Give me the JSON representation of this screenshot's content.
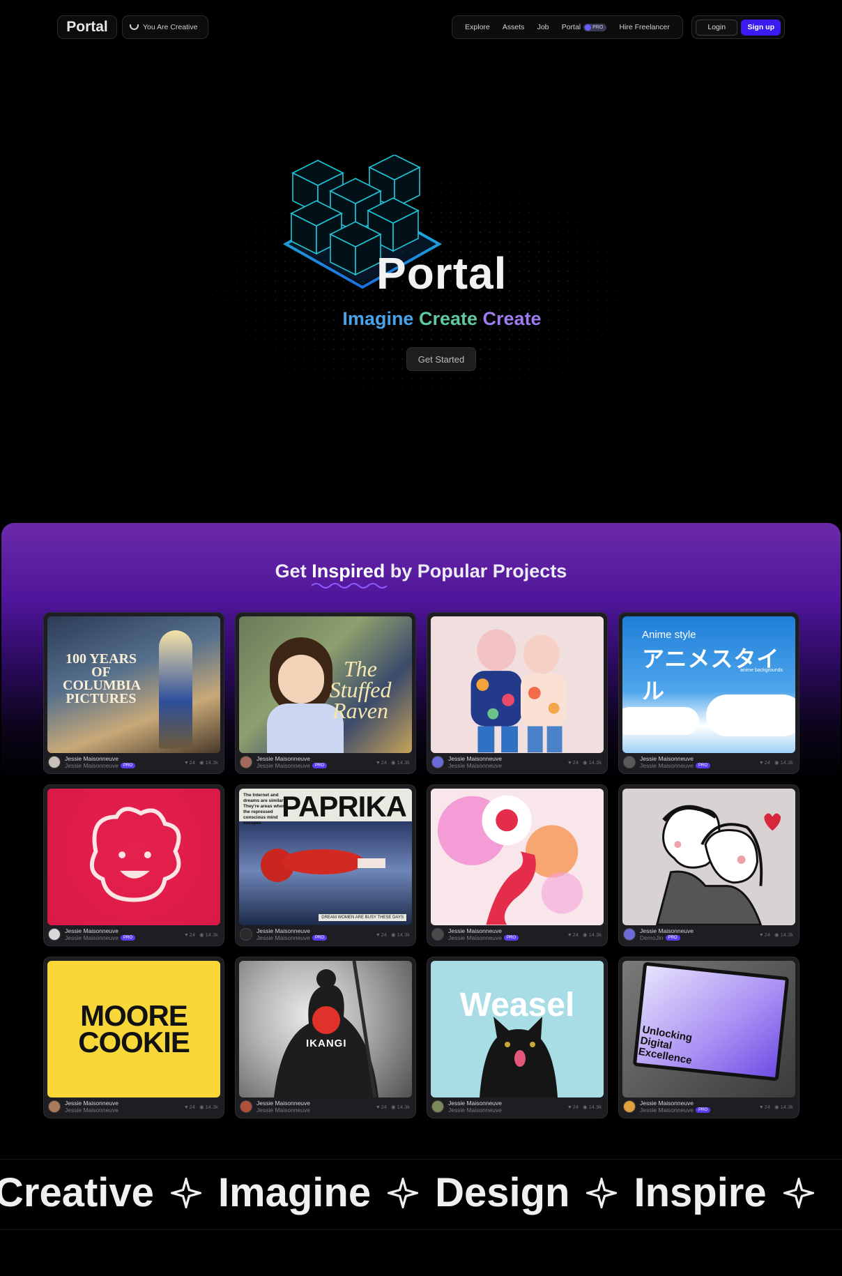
{
  "nav": {
    "logo": "Portal",
    "creative_pill": "You Are Creative",
    "menu": {
      "explore": "Explore",
      "assets": "Assets",
      "job": "Job",
      "portal": "Portal",
      "portal_badge": "PRO",
      "hire": "Hire Freelancer"
    },
    "login": "Login",
    "signup": "Sign up"
  },
  "hero": {
    "title": "Portal",
    "tagline": [
      "Imagine",
      "Create",
      "Create"
    ],
    "cta": "Get Started"
  },
  "inspired": {
    "title_prefix": "Get",
    "title_em": "Inspired",
    "title_suffix": "by Popular Projects",
    "cards": [
      {
        "author": "Jessie Maisonneuve",
        "sub": "Jessie Maisonneuve",
        "pro": "PRO",
        "likes": "24",
        "views": "14.3k",
        "art_text": "100 YEARS OF COLUMBIA PICTURES"
      },
      {
        "author": "Jessie Maisonneuve",
        "sub": "Jessie Maisonneuve",
        "pro": "PRO",
        "likes": "24",
        "views": "14.3k",
        "art_text": "The Stuffed Raven"
      },
      {
        "author": "Jessie Maisonneuve",
        "sub": "Jessie Maisonneuve",
        "pro": "",
        "likes": "24",
        "views": "14.3k",
        "art_text": ""
      },
      {
        "author": "Jessie Maisonneuve",
        "sub": "Jessie Maisonneuve",
        "pro": "PRO",
        "likes": "24",
        "views": "14.3k",
        "art_text": "Anime style",
        "art_jp": "アニメスタイル",
        "art_sub": "anime backgrounds"
      },
      {
        "author": "Jessie Maisonneuve",
        "sub": "Jessie Maisonneuve",
        "pro": "PRO",
        "likes": "24",
        "views": "14.3k",
        "art_text": ""
      },
      {
        "author": "Jessie Maisonneuve",
        "sub": "Jessie Maisonneuve",
        "pro": "PRO",
        "likes": "24",
        "views": "14.3k",
        "art_text": "PAPRIKA",
        "art_small": "The Internet and dreams are similar They're areas where the repressed conscious mind escapes",
        "art_foot": "DREAM WOMEN ARE BUSY THESE DAYS"
      },
      {
        "author": "Jessie Maisonneuve",
        "sub": "Jessie Maisonneuve",
        "pro": "PRO",
        "likes": "24",
        "views": "14.3k",
        "art_text": ""
      },
      {
        "author": "Jessie Maisonneuve",
        "sub": "DemoJin",
        "pro": "PRO",
        "likes": "24",
        "views": "14.3k",
        "art_text": ""
      },
      {
        "author": "Jessie Maisonneuve",
        "sub": "Jessie Maisonneuve",
        "pro": "",
        "likes": "24",
        "views": "14.3k",
        "art_text": "MOORE COOKIE"
      },
      {
        "author": "Jessie Maisonneuve",
        "sub": "Jessie Maisonneuve",
        "pro": "",
        "likes": "24",
        "views": "14.3k",
        "art_text": "IKANGI"
      },
      {
        "author": "Jessie Maisonneuve",
        "sub": "Jessie Maisonneuve",
        "pro": "",
        "likes": "24",
        "views": "14.3k",
        "art_text": "Weasel"
      },
      {
        "author": "Jessie Maisonneuve",
        "sub": "Jessie Maisonneuve",
        "pro": "PRO",
        "likes": "24",
        "views": "14.3k",
        "art_text": "Unlocking Digital Excellence"
      }
    ]
  },
  "marquee": {
    "words": [
      "Creative",
      "Imagine",
      "Design",
      "Inspire"
    ]
  },
  "colors": {
    "accent": "#3b1cf0",
    "tagline_1": "#4aa3e8",
    "tagline_2": "#5fc9a0",
    "tagline_3": "#9d7cf0",
    "section_purple": "#6b2aa8"
  }
}
